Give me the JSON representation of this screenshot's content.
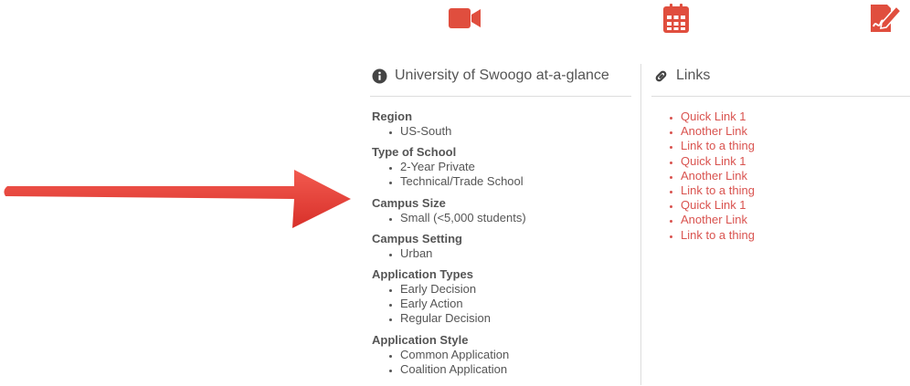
{
  "colors": {
    "accent": "#e04e3e",
    "arrow": "#e9423c",
    "link": "#d9534f",
    "text": "#555555",
    "divider": "#dddddd"
  },
  "top_icons": [
    "video-camera-icon",
    "calendar-icon",
    "signature-icon"
  ],
  "glance": {
    "icon": "info-circle-icon",
    "title": "University of Swoogo at-a-glance",
    "sections": [
      {
        "title": "Region",
        "items": [
          "US-South"
        ]
      },
      {
        "title": "Type of School",
        "items": [
          "2-Year Private",
          "Technical/Trade School"
        ]
      },
      {
        "title": "Campus Size",
        "items": [
          "Small (<5,000 students)"
        ]
      },
      {
        "title": "Campus Setting",
        "items": [
          "Urban"
        ]
      },
      {
        "title": "Application Types",
        "items": [
          "Early Decision",
          "Early Action",
          "Regular Decision"
        ]
      },
      {
        "title": "Application Style",
        "items": [
          "Common Application",
          "Coalition Application"
        ]
      }
    ]
  },
  "links": {
    "icon": "link-icon",
    "title": "Links",
    "items": [
      "Quick Link 1",
      "Another Link",
      "Link to a thing",
      "Quick Link 1",
      "Another Link",
      "Link to a thing",
      "Quick Link 1",
      "Another Link",
      "Link to a thing"
    ]
  }
}
